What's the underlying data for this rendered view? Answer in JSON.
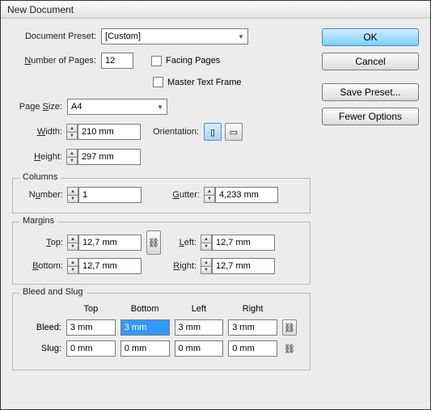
{
  "title": "New Document",
  "labels": {
    "docPreset": "Document Preset:",
    "numPages": "Number of Pages:",
    "facingPages": "Facing Pages",
    "masterTextFrame": "Master Text Frame",
    "pageSize": "Page Size:",
    "width": "Width:",
    "height": "Height:",
    "orientation": "Orientation:",
    "columns": "Columns",
    "number": "Number:",
    "gutter": "Gutter:",
    "margins": "Margins",
    "top": "Top:",
    "bottom": "Bottom:",
    "left": "Left:",
    "right": "Right:",
    "bleedSlug": "Bleed and Slug",
    "colTop": "Top",
    "colBottom": "Bottom",
    "colLeft": "Left",
    "colRight": "Right",
    "bleed": "Bleed:",
    "slug": "Slug:"
  },
  "values": {
    "preset": "[Custom]",
    "pages": "12",
    "pageSize": "A4",
    "width": "210 mm",
    "height": "297 mm",
    "colNumber": "1",
    "gutter": "4,233 mm",
    "mTop": "12,7 mm",
    "mBottom": "12,7 mm",
    "mLeft": "12,7 mm",
    "mRight": "12,7 mm",
    "bTop": "3 mm",
    "bBottom": "3 mm",
    "bLeft": "3 mm",
    "bRight": "3 mm",
    "sTop": "0 mm",
    "sBottom": "0 mm",
    "sLeft": "0 mm",
    "sRight": "0 mm"
  },
  "buttons": {
    "ok": "OK",
    "cancel": "Cancel",
    "savePreset": "Save Preset...",
    "fewerOptions": "Fewer Options"
  }
}
